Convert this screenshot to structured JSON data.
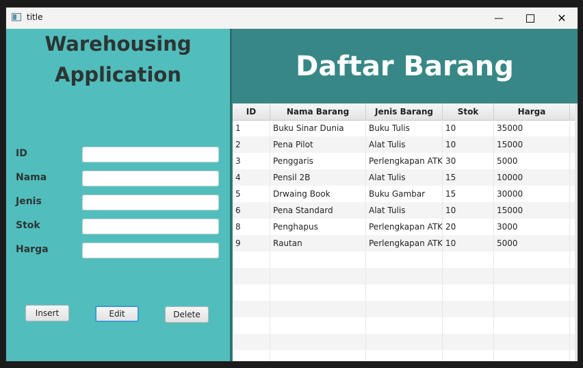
{
  "window": {
    "title": "title"
  },
  "left": {
    "heading_line1": "Warehousing",
    "heading_line2": "Application",
    "fields": [
      {
        "label": "ID",
        "value": ""
      },
      {
        "label": "Nama",
        "value": ""
      },
      {
        "label": "Jenis",
        "value": ""
      },
      {
        "label": "Stok",
        "value": ""
      },
      {
        "label": "Harga",
        "value": ""
      }
    ],
    "buttons": {
      "insert": "Insert",
      "edit": "Edit",
      "delete": "Delete"
    }
  },
  "right": {
    "heading": "Daftar Barang",
    "columns": [
      "ID",
      "Nama Barang",
      "Jenis Barang",
      "Stok",
      "Harga"
    ],
    "rows": [
      [
        "1",
        "Buku Sinar Dunia",
        "Buku Tulis",
        "10",
        "35000"
      ],
      [
        "2",
        "Pena Pilot",
        "Alat Tulis",
        "10",
        "15000"
      ],
      [
        "3",
        "Penggaris",
        "Perlengkapan ATK",
        "30",
        "5000"
      ],
      [
        "4",
        "Pensil 2B",
        "Alat Tulis",
        "15",
        "10000"
      ],
      [
        "5",
        "Drwaing Book",
        "Buku Gambar",
        "15",
        "30000"
      ],
      [
        "6",
        "Pena Standard",
        "Alat Tulis",
        "10",
        "15000"
      ],
      [
        "8",
        "Penghapus",
        "Perlengkapan ATK",
        "20",
        "3000"
      ],
      [
        "9",
        "Rautan",
        "Perlengkapan ATK",
        "10",
        "5000"
      ]
    ]
  },
  "colors": {
    "left_bg": "#52bdbd",
    "right_bg": "#388787",
    "heading_text": "#2c3533"
  }
}
